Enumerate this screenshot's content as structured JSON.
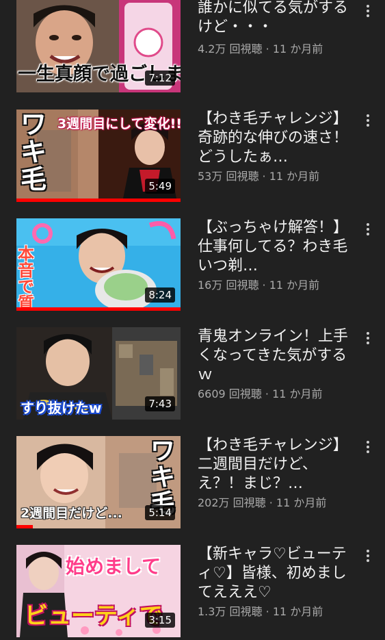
{
  "videos": [
    {
      "title": "誰かに似てる気がするけど・・・",
      "views": "4.2万 回視聴",
      "age": "11 か月前",
      "duration": "7:12",
      "thumb_caption": "一生真顔で過ごします",
      "progress": 0
    },
    {
      "title": "【わき毛チャレンジ】奇跡的な伸びの速さ！どうしたぁ…",
      "views": "53万 回視聴",
      "age": "11 か月前",
      "duration": "5:49",
      "thumb_caption": "3週間目にして変化!!!",
      "thumb_big": "ワキ毛",
      "progress": 1.0
    },
    {
      "title": "【ぶっちゃけ解答！】仕事何してる？わき毛いつ剃…",
      "views": "16万 回視聴",
      "age": "11 か月前",
      "duration": "8:24",
      "thumb_caption": "本音で質問回答",
      "progress": 1.0
    },
    {
      "title": "青鬼オンライン！上手くなってきた気がするｗ",
      "views": "6609 回視聴",
      "age": "11 か月前",
      "duration": "7:43",
      "thumb_caption": "すり抜けたw",
      "progress": 0
    },
    {
      "title": "【わき毛チャレンジ】二週間目だけど、え？！まじ？…",
      "views": "202万 回視聴",
      "age": "11 か月前",
      "duration": "5:14",
      "thumb_caption": "2週間目だけど...",
      "thumb_big": "ワキ毛",
      "progress": 0.1
    },
    {
      "title": "【新キャラ♡ビューティ♡】皆様、初めましてえええ♡",
      "views": "1.3万 回視聴",
      "age": "11 か月前",
      "duration": "3:15",
      "thumb_caption": "始めまして",
      "thumb_big": "ビューティで",
      "progress": 0
    }
  ],
  "separator": " · ",
  "colors": {
    "background": "#212121",
    "title": "#f1f1f1",
    "meta": "#aaaaaa",
    "progress": "#ff0000"
  }
}
